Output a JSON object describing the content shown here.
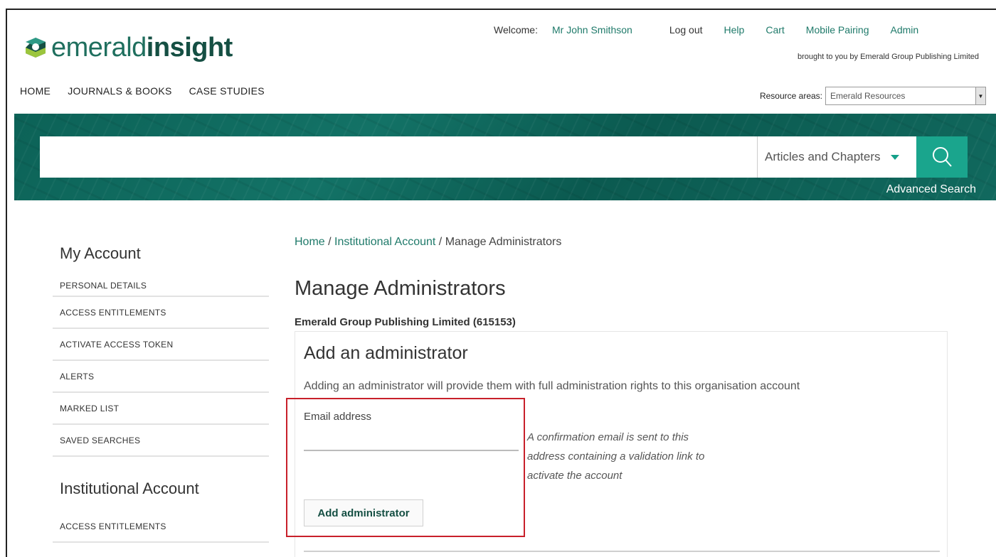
{
  "logo": {
    "light": "emerald",
    "bold": "insight"
  },
  "main_nav": [
    "HOME",
    "JOURNALS & BOOKS",
    "CASE STUDIES"
  ],
  "top_bar": {
    "welcome": "Welcome:",
    "user": "Mr John Smithson",
    "links": [
      "Log out",
      "Help",
      "Cart",
      "Mobile Pairing",
      "Admin"
    ],
    "brought_by": "brought to you by Emerald Group Publishing Limited"
  },
  "resource_areas": {
    "label": "Resource areas:",
    "selected": "Emerald Resources"
  },
  "search": {
    "query": "",
    "scope": "Articles and Chapters",
    "advanced": "Advanced Search"
  },
  "sidebar": {
    "my_account_title": "My Account",
    "my_account_items": [
      "PERSONAL DETAILS",
      "ACCESS ENTITLEMENTS",
      "ACTIVATE ACCESS TOKEN",
      "ALERTS",
      "MARKED LIST",
      "SAVED SEARCHES"
    ],
    "institutional_title": "Institutional Account",
    "institutional_items": [
      "ACCESS ENTITLEMENTS"
    ]
  },
  "breadcrumb": {
    "home": "Home",
    "sep": " / ",
    "institutional": "Institutional Account",
    "current": "Manage Administrators"
  },
  "page": {
    "title": "Manage Administrators",
    "organisation": "Emerald Group Publishing Limited (615153)"
  },
  "add_admin": {
    "heading": "Add an administrator",
    "description": "Adding an administrator will provide them with full administration rights to this organisation account",
    "email_label": "Email address",
    "email_value": "",
    "note": "A confirmation email is sent to this address containing a validation link to activate the account",
    "button": "Add administrator"
  },
  "colors": {
    "brand_dark": "#154f43",
    "brand": "#1f7a6a",
    "band": "#0c6257",
    "search_button": "#1aa58d",
    "highlight": "#c8202a"
  }
}
